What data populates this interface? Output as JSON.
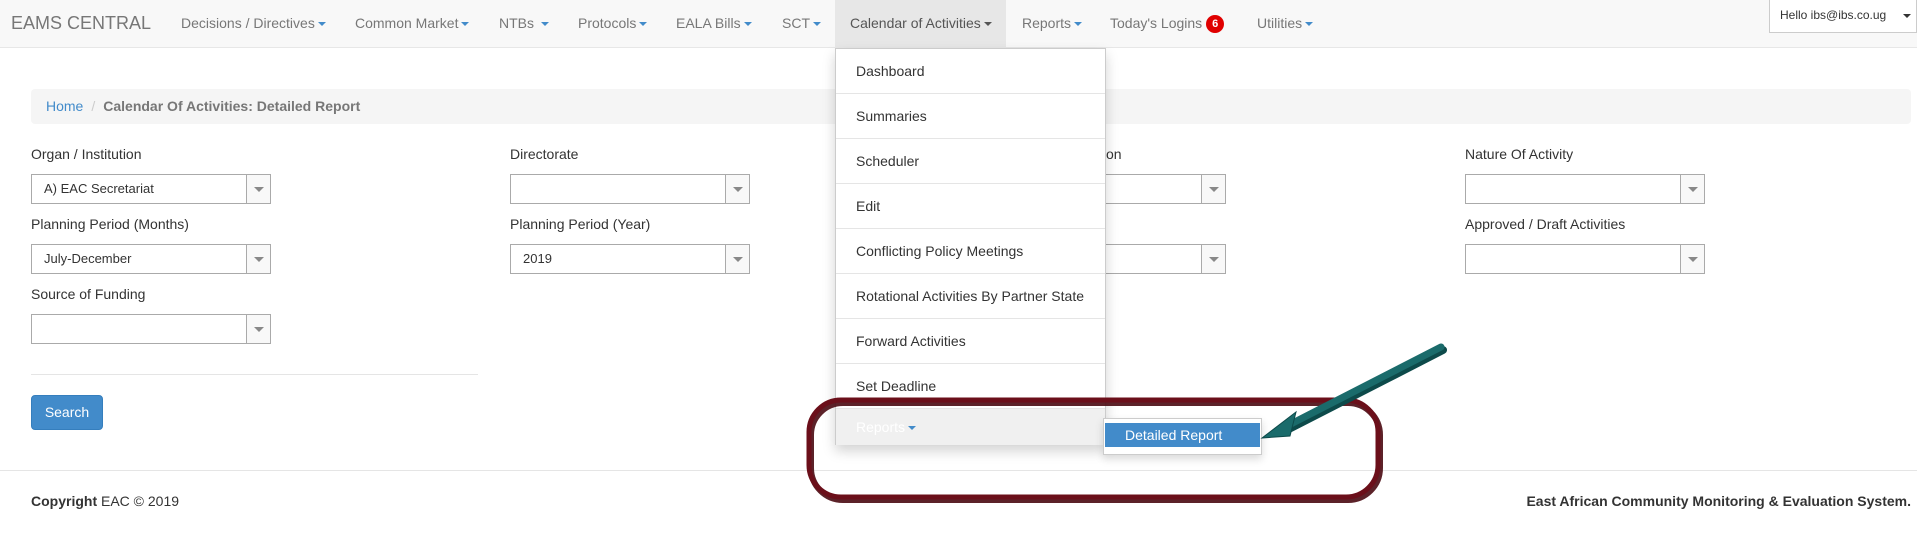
{
  "navbar": {
    "brand": "EAMS CENTRAL",
    "items": [
      {
        "label": "Decisions / Directives"
      },
      {
        "label": "Common Market"
      },
      {
        "label": "NTBs"
      },
      {
        "label": "Protocols"
      },
      {
        "label": "EALA Bills"
      },
      {
        "label": "SCT"
      },
      {
        "label": "Calendar of Activities"
      },
      {
        "label": "Reports"
      },
      {
        "label": "Today's Logins",
        "badge": "6"
      },
      {
        "label": "Utilities"
      }
    ],
    "user": "Hello ibs@ibs.co.ug"
  },
  "breadcrumb": {
    "home": "Home",
    "separator": "/",
    "current": "Calendar Of Activities: Detailed Report"
  },
  "form": {
    "organ_label": "Organ / Institution",
    "organ_value": "A) EAC Secretariat",
    "directorate_label": "Directorate",
    "directorate_value": "",
    "division_label_partial": "on",
    "nature_label": "Nature Of Activity",
    "nature_value": "",
    "period_months_label": "Planning Period (Months)",
    "period_months_value": "July-December",
    "period_year_label": "Planning Period (Year)",
    "period_year_value": "2019",
    "approved_label": "Approved / Draft Activities",
    "approved_value": "",
    "funding_label": "Source of Funding",
    "funding_value": "",
    "search_button": "Search"
  },
  "dropdown": {
    "items": [
      "Dashboard",
      "Summaries",
      "Scheduler",
      "Edit",
      "Conflicting Policy Meetings",
      "Rotational Activities By Partner State",
      "Forward Activities",
      "Set Deadline"
    ],
    "submenu_parent": "Reports",
    "submenu_item": "Detailed Report"
  },
  "footer": {
    "copyright_bold": "Copyright",
    "copyright_rest": "EAC © 2019",
    "system_name": "East African Community Monitoring & Evaluation System."
  },
  "colors": {
    "accent": "#428bca",
    "badge": "#e00000",
    "annotation_ring": "#6b0f1a",
    "annotation_arrow": "#1a6b6b"
  }
}
